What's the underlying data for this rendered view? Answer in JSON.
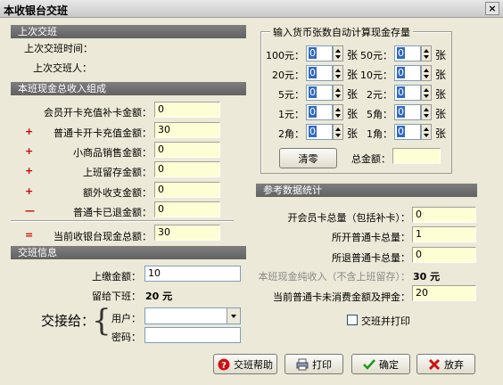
{
  "window": {
    "title": "本收银台交班",
    "close_glyph": "×"
  },
  "last_shift": {
    "header": "上次交班",
    "time_label": "上次交班时间：",
    "person_label": "上次交班人："
  },
  "cash_composition": {
    "header": "本班现金总收入组成",
    "rows": [
      {
        "sym": "",
        "label": "会员开卡充值补卡金额：",
        "value": "0"
      },
      {
        "sym": "+",
        "label": "普通卡开卡充值金额：",
        "value": "30"
      },
      {
        "sym": "+",
        "label": "小商品销售金额：",
        "value": "0"
      },
      {
        "sym": "+",
        "label": "上班留存金额：",
        "value": "0"
      },
      {
        "sym": "+",
        "label": "额外收支金额：",
        "value": "0"
      },
      {
        "sym": "—",
        "label": "普通卡已退金额：",
        "value": "0"
      }
    ],
    "total": {
      "sym": "=",
      "label": "当前收银台现金总额：",
      "value": "30"
    }
  },
  "shift_info": {
    "header": "交班信息",
    "submit_label": "上缴金额：",
    "submit_value": "10",
    "leave_label": "留给下班：",
    "leave_value": "20 元",
    "handover_label": "交接给：",
    "user_label": "用户：",
    "user_value": "",
    "password_label": "密码：",
    "password_value": ""
  },
  "denominations": {
    "title": "输入货币张数自动计算现金存量",
    "unit": "张",
    "rows": [
      {
        "left": {
          "label": "100元：",
          "value": "0"
        },
        "right": {
          "label": "50元：",
          "value": "0"
        }
      },
      {
        "left": {
          "label": "20元：",
          "value": "0"
        },
        "right": {
          "label": "10元：",
          "value": "0"
        }
      },
      {
        "left": {
          "label": "5元：",
          "value": "0"
        },
        "right": {
          "label": "2元：",
          "value": "0"
        }
      },
      {
        "left": {
          "label": "1元：",
          "value": "0"
        },
        "right": {
          "label": "5角：",
          "value": "0"
        }
      },
      {
        "left": {
          "label": "2角：",
          "value": "0"
        },
        "right": {
          "label": "1角：",
          "value": "0"
        }
      }
    ],
    "clear_label": "清零",
    "total_label": "总金额：",
    "total_value": ""
  },
  "reference": {
    "header": "参考数据统计",
    "rows": [
      {
        "label": "开会员卡总量（包括补卡）：",
        "value": "0"
      },
      {
        "label": "所开普通卡总量：",
        "value": "1"
      },
      {
        "label": "所退普通卡总量：",
        "value": "0"
      }
    ],
    "net_label": "本班现金纯收入（不含上班留存）：",
    "net_value": "30 元",
    "deposit_label": "当前普通卡未消费金额及押金：",
    "deposit_value": "20",
    "print_on_shift_label": "交班并打印"
  },
  "buttons": {
    "help": "交班帮助",
    "print": "打印",
    "ok": "确定",
    "cancel": "放弃"
  }
}
